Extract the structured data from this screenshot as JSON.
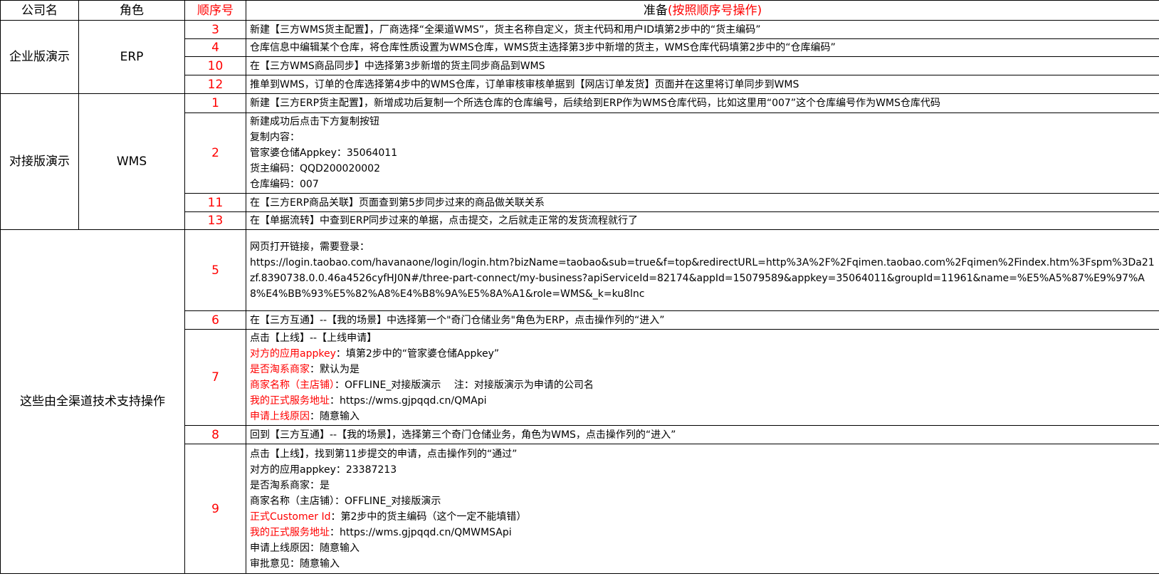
{
  "header": {
    "company": "公司名",
    "role": "角色",
    "seq": "顺序号",
    "prep_prefix": "准备",
    "prep_red": "(按照顺序号操作)"
  },
  "groups": {
    "g1": {
      "company": "企业版演示",
      "role": "ERP"
    },
    "g2": {
      "company": "对接版演示",
      "role": "WMS"
    },
    "g3": {
      "company": "这些由全渠道技术支持操作",
      "role": ""
    }
  },
  "rows": {
    "r3": {
      "seq": "3",
      "text": "新建【三方WMS货主配置】，厂商选择“全渠道WMS”，货主名称自定义，货主代码和用户ID填第2步中的“货主编码”"
    },
    "r4": {
      "seq": "4",
      "text": "仓库信息中编辑某个仓库，将仓库性质设置为WMS仓库，WMS货主选择第3步中新增的货主，WMS仓库代码填第2步中的“仓库编码”"
    },
    "r10": {
      "seq": "10",
      "text": "在【三方WMS商品同步】中选择第3步新增的货主同步商品到WMS"
    },
    "r12": {
      "seq": "12",
      "text": "推单到WMS，订单的仓库选择第4步中的WMS仓库，订单审核审核单据到【网店订单发货】页面并在这里将订单同步到WMS"
    },
    "r1": {
      "seq": "1",
      "text": "新建【三方ERP货主配置】，新增成功后复制一个所选仓库的仓库编号，后续给到ERP作为WMS仓库代码，比如这里用“007”这个仓库编号作为WMS仓库代码"
    },
    "r2": {
      "seq": "2",
      "l1": "新建成功后点击下方复制按钮",
      "l2": "复制内容：",
      "l3": "管家婆仓储Appkey：35064011",
      "l4": "货主编码：QQD200020002",
      "l5": "仓库编码：007"
    },
    "r11": {
      "seq": "11",
      "text": "在【三方ERP商品关联】页面查到第5步同步过来的商品做关联关系"
    },
    "r13": {
      "seq": "13",
      "text": "在【单据流转】中查到ERP同步过来的单据，点击提交，之后就走正常的发货流程就行了"
    },
    "r5": {
      "seq": "5",
      "l1": "网页打开链接，需要登录：",
      "l2": "https://login.taobao.com/havanaone/login/login.htm?bizName=taobao&sub=true&f=top&redirectURL=http%3A%2F%2Fqimen.taobao.com%2Fqimen%2Findex.htm%3Fspm%3Da21zf.8390738.0.0.46a4526cyfHJ0N#/three-part-connect/my-business?apiServiceId=82174&appId=15079589&appkey=35064011&groupId=11961&name=%E5%A5%87%E9%97%A8%E4%BB%93%E5%82%A8%E4%B8%9A%E5%8A%A1&role=WMS&_k=ku8lnc"
    },
    "r6": {
      "seq": "6",
      "text": "在【三方互通】--【我的场景】中选择第一个\"奇门仓储业务\"角色为ERP，点击操作列的“进入”"
    },
    "r7": {
      "seq": "7",
      "l1": "点击【上线】--【上线申请】",
      "l2_red": "对方的应用appkey",
      "l2_rest": "：填第2步中的“管家婆仓储Appkey”",
      "l3_red": "是否淘系商家",
      "l3_rest": "：默认为是",
      "l4_red": "商家名称（主店铺）",
      "l4_rest": "：OFFLINE_对接版演示　 注：对接版演示为申请的公司名",
      "l5_red": "我的正式服务地址",
      "l5_rest": "：https://wms.gjpqqd.cn/QMApi",
      "l6_red": "申请上线原因",
      "l6_rest": "：随意输入"
    },
    "r8": {
      "seq": "8",
      "text": "回到【三方互通】--【我的场景】，选择第三个奇门仓储业务，角色为WMS，点击操作列的“进入”"
    },
    "r9": {
      "seq": "9",
      "l1": "点击【上线】，找到第11步提交的申请，点击操作列的“通过”",
      "l2": "对方的应用appkey：23387213",
      "l3": "是否淘系商家：是",
      "l4": "商家名称（主店铺）：OFFLINE_对接版演示",
      "l5_red": "正式Customer Id",
      "l5_rest": "：第2步中的货主编码（这个一定不能填错）",
      "l6_red": "我的正式服务地址",
      "l6_rest": "：https://wms.gjpqqd.cn/QMWMSApi",
      "l7": "申请上线原因：随意输入",
      "l8": "审批意见：随意输入"
    }
  }
}
